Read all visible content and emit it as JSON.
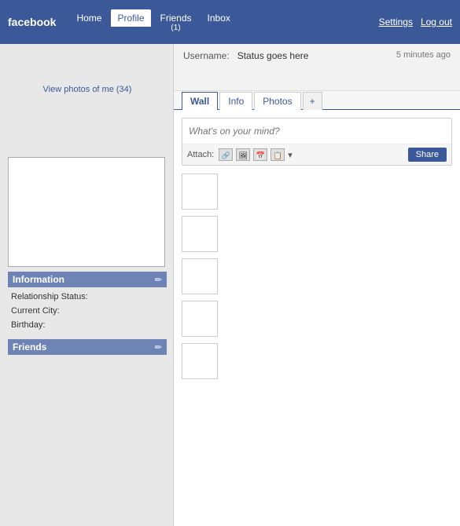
{
  "nav": {
    "brand": "facebook",
    "links": [
      {
        "label": "Home",
        "active": false,
        "badge": null
      },
      {
        "label": "Profile",
        "active": true,
        "badge": null
      },
      {
        "label": "Friends",
        "active": false,
        "badge": "(1)"
      },
      {
        "label": "Inbox",
        "active": false,
        "badge": null
      }
    ],
    "right": {
      "settings": "Settings",
      "logout": "Log out"
    }
  },
  "profile": {
    "username_label": "Username:",
    "status": "Status goes here",
    "time_ago": "5 minutes ago"
  },
  "tabs": {
    "items": [
      "Wall",
      "Info",
      "Photos",
      "+"
    ]
  },
  "status_box": {
    "placeholder": "What's on your mind?",
    "attach_label": "Attach:",
    "share_button": "Share",
    "icons": [
      "📎",
      "🖼",
      "📅",
      "📋"
    ]
  },
  "sidebar": {
    "view_photos": "View photos of me (34)",
    "information": {
      "header": "Information",
      "relationship_label": "Relationship Status:",
      "city_label": "Current City:",
      "birthday_label": "Birthday:"
    },
    "friends": {
      "header": "Friends"
    }
  }
}
